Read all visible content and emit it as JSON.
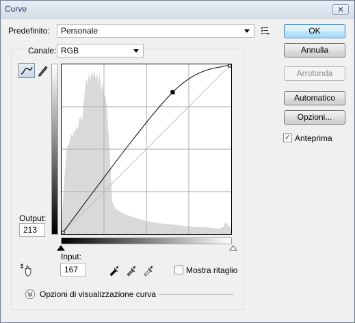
{
  "window": {
    "title": "Curve",
    "close_glyph": "✕"
  },
  "preset": {
    "label": "Predefinito:",
    "value": "Personale"
  },
  "channel": {
    "label": "Canale:",
    "value": "RGB"
  },
  "buttons": {
    "ok": "OK",
    "cancel": "Annulla",
    "smooth": "Arrotonda",
    "auto": "Automatico",
    "options": "Opzioni..."
  },
  "preview": {
    "label": "Anteprima",
    "checked": true
  },
  "output": {
    "label": "Output:",
    "value": "213"
  },
  "input": {
    "label": "Input:",
    "value": "167"
  },
  "clipping": {
    "label": "Mostra ritaglio",
    "checked": false
  },
  "display_options": {
    "label": "Opzioni di visualizzazione curva"
  },
  "icons": {
    "curve_tool": "curve-edit-icon",
    "pencil_tool": "pencil-icon",
    "target_adjust": "hand-adjust-icon",
    "black_point": "black-eyedropper-icon",
    "gray_point": "gray-eyedropper-icon",
    "white_point": "white-eyedropper-icon",
    "expand": "chevron-down-circle-icon",
    "preset_menu": "preset-options-icon"
  },
  "curve": {
    "points": [
      [
        0,
        0
      ],
      [
        167,
        213
      ],
      [
        255,
        255
      ]
    ],
    "histogram_color": "#d9d9d9"
  }
}
